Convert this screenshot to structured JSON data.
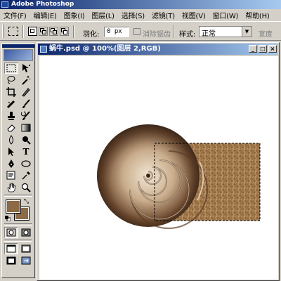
{
  "app": {
    "title": "Adobe Photoshop"
  },
  "menubar": {
    "items": [
      {
        "label": "文件(F)"
      },
      {
        "label": "编辑(E)"
      },
      {
        "label": "图象(I)"
      },
      {
        "label": "图层(L)"
      },
      {
        "label": "选择(S)"
      },
      {
        "label": "滤镜(T)"
      },
      {
        "label": "视图(V)"
      },
      {
        "label": "窗口(W)"
      },
      {
        "label": "帮助(H)"
      }
    ]
  },
  "options": {
    "feather_label": "羽化:",
    "feather_value": "0 px",
    "antialias_label": "消除锯齿",
    "style_label": "样式:",
    "style_value": "正常",
    "width_label": "宽度"
  },
  "document": {
    "title": "蜗牛.psd @ 100%(图层 2,RGB)"
  },
  "colors": {
    "foreground": "#8b6a45",
    "background": "#8b6a45"
  }
}
